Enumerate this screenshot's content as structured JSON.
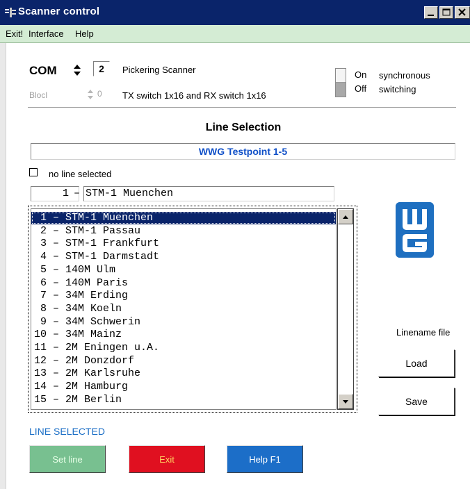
{
  "window": {
    "title": "Scanner control"
  },
  "menu": {
    "items": [
      "Exit!",
      "Interface",
      "Help"
    ]
  },
  "com": {
    "label": "COM",
    "value": "2",
    "description": "Pickering Scanner"
  },
  "blocl": {
    "label": "Blocl",
    "value": "0",
    "description": "TX switch 1x16 and RX switch 1x16"
  },
  "sync": {
    "on_label": "On",
    "off_label": "Off",
    "text_line1": "synchronous",
    "text_line2": "switching",
    "state": "Off"
  },
  "line_selection": {
    "title": "Line Selection",
    "selected_name": "WWG Testpoint 1-5",
    "no_line_label": "no line selected",
    "no_line_checked": false,
    "current_number": "1",
    "current_separator": "–",
    "current_name": "STM-1 Muenchen",
    "selected_index": 0,
    "lines": [
      " 1 – STM-1 Muenchen",
      " 2 – STM-1 Passau",
      " 3 – STM-1 Frankfurt",
      " 4 – STM-1 Darmstadt",
      " 5 – 140M Ulm",
      " 6 – 140M Paris",
      " 7 – 34M Erding",
      " 8 – 34M Koeln",
      " 9 – 34M Schwerin",
      "10 – 34M Mainz",
      "11 – 2M Eningen u.A.",
      "12 – 2M Donzdorf",
      "13 – 2M Karlsruhe",
      "14 – 2M Hamburg",
      "15 – 2M Berlin"
    ]
  },
  "logo": {
    "icon": "wg-logo-icon",
    "color": "#1e6fc0"
  },
  "linename_file": {
    "label": "Linename file",
    "load_label": "Load",
    "save_label": "Save"
  },
  "status": {
    "text": "LINE SELECTED",
    "color": "#1c6fc6"
  },
  "bottom_buttons": {
    "set_line": {
      "label": "Set line",
      "bg": "#78c090",
      "fg": "#e8ffe8"
    },
    "exit": {
      "label": "Exit",
      "bg": "#e01020",
      "fg": "#ffd060"
    },
    "help": {
      "label": "Help F1",
      "bg": "#1c6ec8",
      "fg": "#ffffff"
    }
  }
}
